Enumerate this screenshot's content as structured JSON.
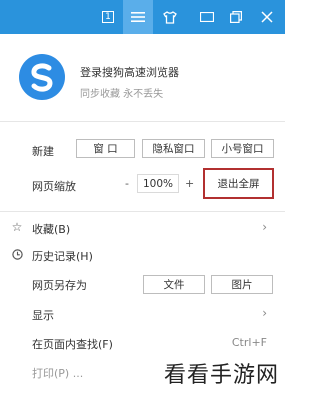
{
  "topbar": {
    "badge_number": "1",
    "icons": [
      "window-count-icon",
      "menu-icon",
      "shirt-skin-icon",
      "exit-fullscreen-icon",
      "restore-icon",
      "close-icon"
    ]
  },
  "profile": {
    "title": "登录搜狗高速浏览器",
    "subtitle": "同步收藏 永不丢失"
  },
  "new_row": {
    "label": "新建",
    "window_btn": "窗 口",
    "private_btn": "隐私窗口",
    "small_btn": "小号窗口"
  },
  "zoom_row": {
    "label": "网页缩放",
    "minus": "-",
    "value": "100%",
    "plus": "+",
    "exit_fullscreen": "退出全屏"
  },
  "menu": {
    "favorites": "收藏(B)",
    "history": "历史记录(H)",
    "save_as": "网页另存为",
    "save_file": "文件",
    "save_image": "图片",
    "display": "显示",
    "find": "在页面内查找(F)",
    "find_shortcut": "Ctrl+F",
    "print": "打印(P) ..."
  },
  "watermark": "看看手游网"
}
